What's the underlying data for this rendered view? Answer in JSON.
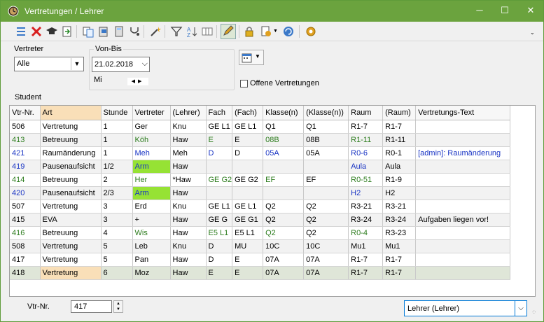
{
  "window": {
    "title": "Vertretungen / Lehrer",
    "minimize": "─",
    "maximize": "☐",
    "close": "✕"
  },
  "filters": {
    "vertreter_label": "Vertreter",
    "vertreter_value": "Alle",
    "vonbis_label": "Von-Bis",
    "date_value": "21.02.2018",
    "weekday": "Mi",
    "offene_label": "Offene Vertretungen",
    "student_label": "Student"
  },
  "table": {
    "columns": [
      "Vtr-Nr.",
      "Art",
      "Stunde",
      "Vertreter",
      "(Lehrer)",
      "Fach",
      "(Fach)",
      "Klasse(n)",
      "(Klasse(n))",
      "Raum",
      "(Raum)",
      "Vertretungs-Text"
    ],
    "rows": [
      {
        "nr": "506",
        "art": "Vertretung",
        "stunde": "1",
        "vertreter": "Ger",
        "lehrer": "Knu",
        "fach": "GE L1",
        "fach2": "GE L1",
        "klasse": "Q1",
        "klasse2": "Q1",
        "raum": "R1-7",
        "raum2": "R1-7",
        "text": "",
        "color": "black",
        "green": false
      },
      {
        "nr": "413",
        "art": "Betreuung",
        "stunde": "1",
        "vertreter": "Köh",
        "lehrer": "Haw",
        "fach": "E",
        "fach2": "E",
        "klasse": "08B",
        "klasse2": "08B",
        "raum": "R1-11",
        "raum2": "R1-11",
        "text": "",
        "color": "green",
        "green": false
      },
      {
        "nr": "421",
        "art": "Raumänderung",
        "stunde": "1",
        "vertreter": "Meh",
        "lehrer": "Meh",
        "fach": "D",
        "fach2": "D",
        "klasse": "05A",
        "klasse2": "05A",
        "raum": "R0-6",
        "raum2": "R0-1",
        "text": "[admin]: Raumänderung",
        "color": "blue",
        "green": false
      },
      {
        "nr": "419",
        "art": "Pausenaufsicht",
        "stunde": "1/2",
        "vertreter": "Arm",
        "lehrer": "Haw",
        "fach": "",
        "fach2": "",
        "klasse": "",
        "klasse2": "",
        "raum": "Aula",
        "raum2": "Aula",
        "text": "",
        "color": "blue",
        "green": true
      },
      {
        "nr": "414",
        "art": "Betreuung",
        "stunde": "2",
        "vertreter": "Her",
        "lehrer": "*Haw",
        "fach": "GE G2",
        "fach2": "GE G2",
        "klasse": "EF",
        "klasse2": "EF",
        "raum": "R0-51",
        "raum2": "R1-9",
        "text": "",
        "color": "green",
        "green": false
      },
      {
        "nr": "420",
        "art": "Pausenaufsicht",
        "stunde": "2/3",
        "vertreter": "Arm",
        "lehrer": "Haw",
        "fach": "",
        "fach2": "",
        "klasse": "",
        "klasse2": "",
        "raum": "H2",
        "raum2": "H2",
        "text": "",
        "color": "blue",
        "green": true
      },
      {
        "nr": "507",
        "art": "Vertretung",
        "stunde": "3",
        "vertreter": "Erd",
        "lehrer": "Knu",
        "fach": "GE L1",
        "fach2": "GE L1",
        "klasse": "Q2",
        "klasse2": "Q2",
        "raum": "R3-21",
        "raum2": "R3-21",
        "text": "",
        "color": "black",
        "green": false
      },
      {
        "nr": "415",
        "art": "EVA",
        "stunde": "3",
        "vertreter": "+",
        "lehrer": "Haw",
        "fach": "GE G",
        "fach2": "GE G1",
        "klasse": "Q2",
        "klasse2": "Q2",
        "raum": "R3-24",
        "raum2": "R3-24",
        "text": "Aufgaben liegen vor!",
        "color": "black",
        "green": false
      },
      {
        "nr": "416",
        "art": "Betreuung",
        "stunde": "4",
        "vertreter": "Wis",
        "lehrer": "Haw",
        "fach": "E5 L1",
        "fach2": "E5 L1",
        "klasse": "Q2",
        "klasse2": "Q2",
        "raum": "R0-4",
        "raum2": "R3-23",
        "text": "",
        "color": "green",
        "green": false
      },
      {
        "nr": "508",
        "art": "Vertretung",
        "stunde": "5",
        "vertreter": "Leb",
        "lehrer": "Knu",
        "fach": "D",
        "fach2": "MU",
        "klasse": "10C",
        "klasse2": "10C",
        "raum": "Mu1",
        "raum2": "Mu1",
        "text": "",
        "color": "black",
        "green": false
      },
      {
        "nr": "417",
        "art": "Vertretung",
        "stunde": "5",
        "vertreter": "Pan",
        "lehrer": "Haw",
        "fach": "D",
        "fach2": "E",
        "klasse": "07A",
        "klasse2": "07A",
        "raum": "R1-7",
        "raum2": "R1-7",
        "text": "",
        "color": "black",
        "green": false
      },
      {
        "nr": "418",
        "art": "Vertretung",
        "stunde": "6",
        "vertreter": "Moz",
        "lehrer": "Haw",
        "fach": "E",
        "fach2": "E",
        "klasse": "07A",
        "klasse2": "07A",
        "raum": "R1-7",
        "raum2": "R1-7",
        "text": "",
        "color": "black",
        "green": false
      }
    ]
  },
  "bottom": {
    "vtr_label": "Vtr-Nr.",
    "vtr_value": "417",
    "view_value": "Lehrer (Lehrer)"
  },
  "colors": {
    "title_bar": "#6ba33e",
    "highlight_green": "#96e234",
    "selected_header": "#f9dfb8",
    "text_green": "#2e7d1f",
    "text_blue": "#1a35c4"
  }
}
